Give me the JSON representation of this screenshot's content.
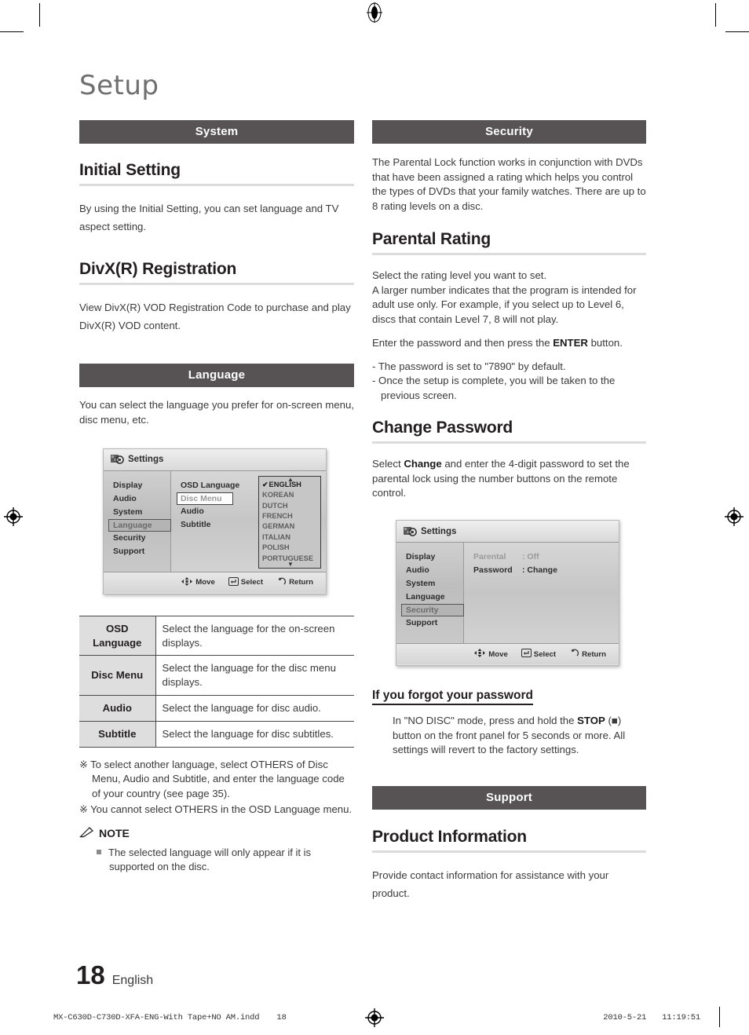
{
  "document": {
    "title": "Setup",
    "page_number": "18",
    "language_label": "English"
  },
  "left_column": {
    "band_system": "System",
    "initial_setting": {
      "heading": "Initial Setting",
      "body": "By using the Initial Setting, you can set language and TV aspect setting."
    },
    "divx": {
      "heading": "DivX(R) Registration",
      "body": "View DivX(R) VOD Registration Code to purchase and play DivX(R) VOD content."
    },
    "band_language": "Language",
    "language_intro": "You can select the language you prefer for on-screen menu, disc menu, etc.",
    "osd_language_screen": {
      "title": "Settings",
      "title_icon": "gear-icon",
      "sidebar": [
        "Display",
        "Audio",
        "System",
        "Language",
        "Security",
        "Support"
      ],
      "sidebar_selected": "Language",
      "menu_items": [
        "OSD Language",
        "Disc Menu",
        "Audio",
        "Subtitle"
      ],
      "menu_highlighted": "Disc Menu",
      "popup_options": [
        "ENGLISH",
        "KOREAN",
        "DUTCH",
        "FRENCH",
        "GERMAN",
        "ITALIAN",
        "POLISH",
        "PORTUGUESE"
      ],
      "popup_checked": "ENGLISH",
      "footer": [
        {
          "icon": "dpad-icon",
          "label": "Move"
        },
        {
          "icon": "enter-icon",
          "label": "Select"
        },
        {
          "icon": "return-icon",
          "label": "Return"
        }
      ]
    },
    "table": {
      "rows": [
        {
          "key": "OSD\nLanguage",
          "key_line1": "OSD",
          "key_line2": "Language",
          "desc": "Select the language for the on-screen displays."
        },
        {
          "key": "Disc Menu",
          "key_line1": "Disc Menu",
          "key_line2": "",
          "desc": "Select the language for the disc menu displays."
        },
        {
          "key": "Audio",
          "key_line1": "Audio",
          "key_line2": "",
          "desc": "Select the language for disc audio."
        },
        {
          "key": "Subtitle",
          "key_line1": "Subtitle",
          "key_line2": "",
          "desc": "Select the language for disc subtitles."
        }
      ]
    },
    "star_notes": [
      "To select another language, select OTHERS of Disc Menu, Audio and Subtitle, and enter the language code of your country (see page 35).",
      "You cannot select OTHERS in the OSD Language menu."
    ],
    "note": {
      "icon": "pencil-icon",
      "heading": "NOTE",
      "items": [
        "The selected language will only appear if it is supported on the disc."
      ]
    }
  },
  "right_column": {
    "band_security": "Security",
    "security_intro": "The Parental Lock function works in conjunction with DVDs that have been assigned a rating which helps you control the types of DVDs that your family watches. There are up to 8 rating levels on a disc.",
    "parental_rating": {
      "heading": "Parental Rating",
      "para1": "Select the rating level you want to set.",
      "para2": "A larger number indicates that the program is intended for adult use only. For example, if you select up to Level 6, discs that contain Level 7, 8 will not play.",
      "para3_before": "Enter the password and then press the ",
      "para3_bold": "ENTER",
      "para3_after": " button.",
      "bullets": [
        "- The password is set to \"7890\" by default.",
        "- Once the setup is complete, you will be taken to the previous screen."
      ]
    },
    "change_password": {
      "heading": "Change Password",
      "body_before": "Select ",
      "body_bold": "Change",
      "body_after": " and enter the 4-digit password to set the parental lock using the number buttons on the remote control."
    },
    "security_screen": {
      "title": "Settings",
      "title_icon": "gear-icon",
      "sidebar": [
        "Display",
        "Audio",
        "System",
        "Language",
        "Security",
        "Support"
      ],
      "sidebar_selected": "Security",
      "settings_rows": [
        {
          "label": "Parental",
          "value": ": Off",
          "dimmed": true
        },
        {
          "label": "Password",
          "value": ": Change",
          "dimmed": false
        }
      ],
      "footer": [
        {
          "icon": "dpad-icon",
          "label": "Move"
        },
        {
          "icon": "enter-icon",
          "label": "Select"
        },
        {
          "icon": "return-icon",
          "label": "Return"
        }
      ]
    },
    "forgot_password": {
      "heading": "If you forgot your password",
      "body_before": "In \"NO DISC\" mode, press and hold the ",
      "body_bold": "STOP",
      "body_after": " (■) button on the front panel for 5 seconds or more. All settings will revert to the factory settings."
    },
    "band_support": "Support",
    "product_information": {
      "heading": "Product Information",
      "body": "Provide contact information for assistance with your product."
    }
  },
  "print_footer": {
    "file_name": "MX-C630D-C730D-XFA-ENG-With Tape+NO AM.indd",
    "page": "18",
    "date": "2010-5-21",
    "time": "11:19:51"
  },
  "colors": {
    "band_bg": "#575354",
    "rule": "#dcdcdc",
    "title": "#6f6f6f",
    "table_key_bg": "#dedede"
  }
}
